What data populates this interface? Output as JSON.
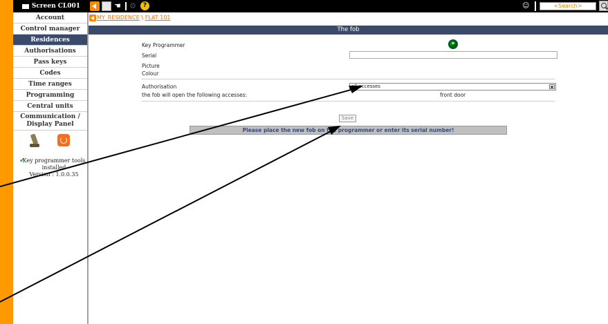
{
  "topbar": {
    "screen_title": "Screen CL001",
    "search_placeholder": "<Search>",
    "icons": [
      "monitor-icon",
      "back-arrow-icon",
      "window-icon",
      "hand-icon",
      "tools-icon",
      "help-icon",
      "user-icon",
      "search-icon"
    ]
  },
  "sidebar": {
    "items": [
      {
        "label": "Account"
      },
      {
        "label": "Control manager"
      },
      {
        "label": "Residences",
        "active": true
      },
      {
        "label": "Authorisations"
      },
      {
        "label": "Pass keys"
      },
      {
        "label": "Codes"
      },
      {
        "label": "Time ranges"
      },
      {
        "label": "Programming"
      },
      {
        "label": "Central units"
      },
      {
        "label": "Communication / Display Panel"
      }
    ],
    "status_line1": "Key programmer tools installed",
    "status_line2": "Version : 1.0.0.35"
  },
  "breadcrumb": {
    "path": [
      "MY_RESIDENCE",
      "FLAT 101"
    ],
    "separator": "\\"
  },
  "main": {
    "section_title": "The fob",
    "fields": {
      "programmer_label": "Key Programmer",
      "serial_label": "Serial",
      "serial_value": "",
      "picture_label": "Picture",
      "colour_label": "Colour",
      "authorisation_label": "Authorisation",
      "authorisation_value": "all accesses",
      "opens_label": "the fob will open the following accesses:",
      "opens_value": "front door"
    },
    "save_label": "Save",
    "message": "Please place the new fob on the programmer or enter its serial number!"
  },
  "colors": {
    "accent": "#ff9900",
    "header": "#3a4a6a",
    "link": "#e87000",
    "led_ok": "#0a8a0a"
  }
}
